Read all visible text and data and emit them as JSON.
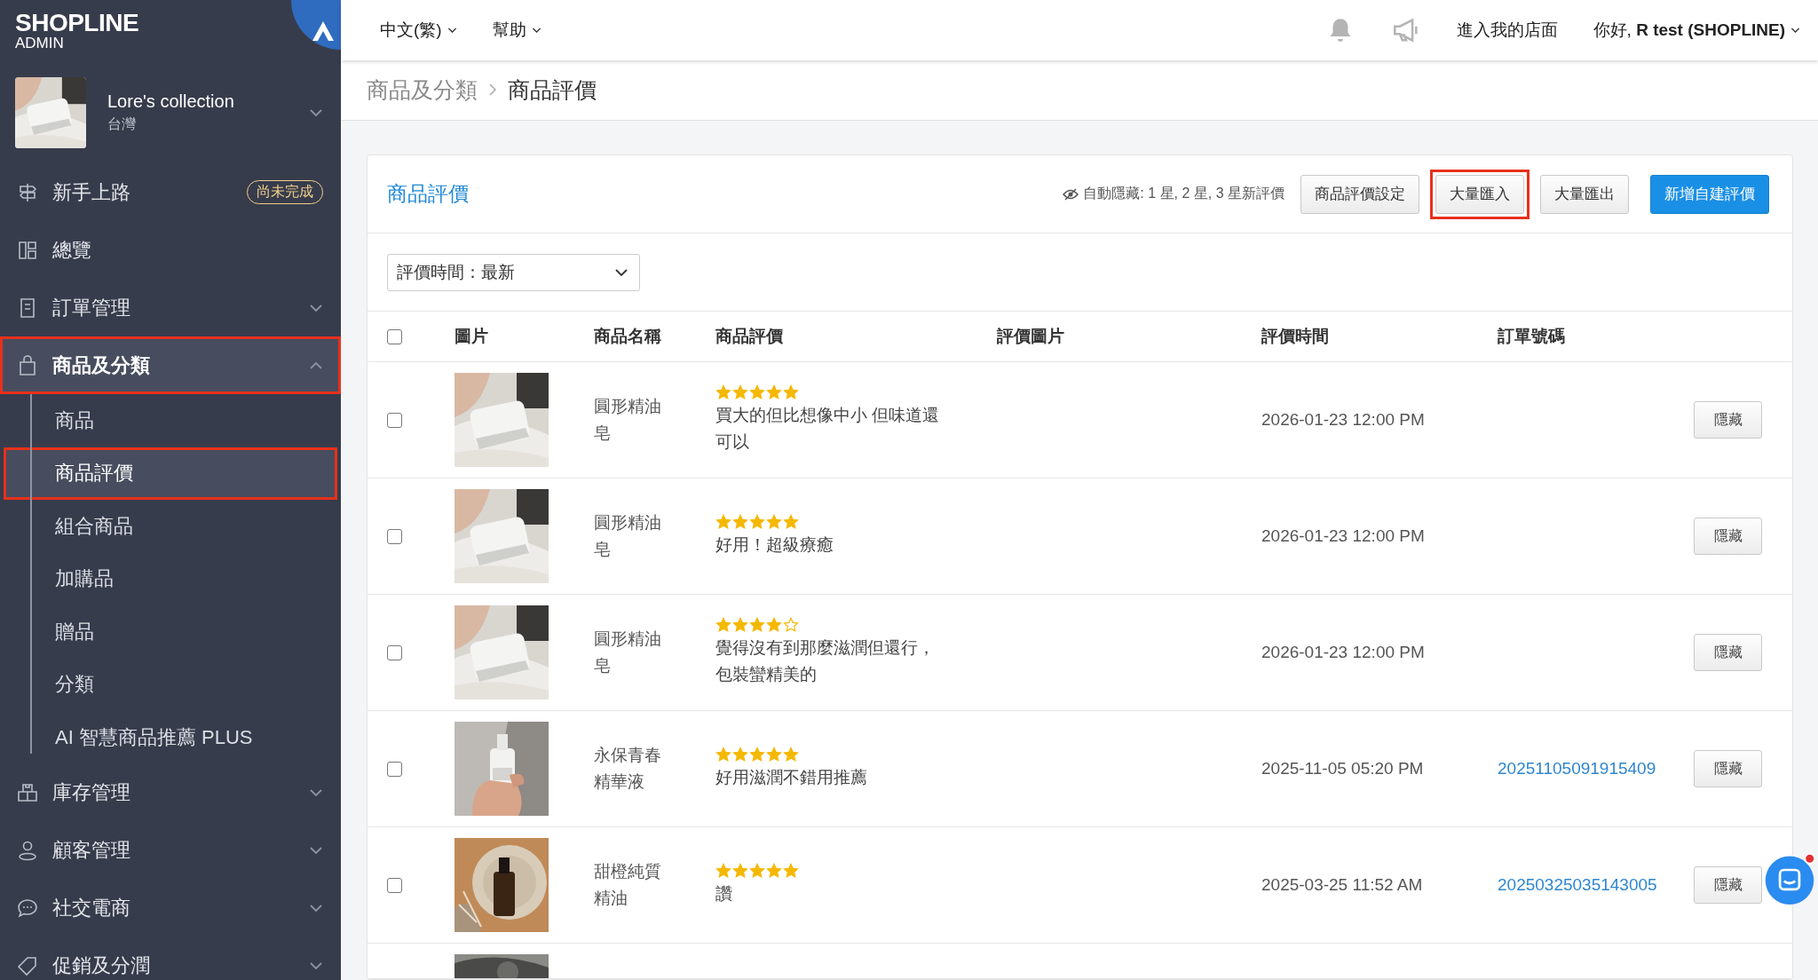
{
  "brand": {
    "name": "SHOPLINE",
    "sub": "ADMIN"
  },
  "store": {
    "name": "Lore's collection",
    "region": "台灣",
    "expanded": false
  },
  "sidebar": {
    "items": [
      {
        "label": "新手上路",
        "badge": "尚未完成",
        "highlighted": false
      },
      {
        "label": "總覽",
        "highlighted": false
      },
      {
        "label": "訂單管理",
        "expanded": false,
        "highlighted": false
      },
      {
        "label": "商品及分類",
        "expanded": true,
        "highlighted": true,
        "children": [
          {
            "label": "商品",
            "selected": false,
            "highlighted": false
          },
          {
            "label": "商品評價",
            "selected": true,
            "highlighted": true
          },
          {
            "label": "組合商品",
            "selected": false,
            "highlighted": false
          },
          {
            "label": "加購品",
            "selected": false,
            "highlighted": false
          },
          {
            "label": "贈品",
            "selected": false,
            "highlighted": false
          },
          {
            "label": "分類",
            "selected": false,
            "highlighted": false
          },
          {
            "label": "AI 智慧商品推薦 PLUS",
            "selected": false,
            "highlighted": false
          }
        ]
      },
      {
        "label": "庫存管理",
        "expanded": false,
        "highlighted": false
      },
      {
        "label": "顧客管理",
        "expanded": false,
        "highlighted": false
      },
      {
        "label": "社交電商",
        "expanded": false,
        "highlighted": false
      },
      {
        "label": "促銷及分潤",
        "expanded": false,
        "highlighted": false
      }
    ]
  },
  "topbar": {
    "menus": [
      "中文(繁)",
      "幫助"
    ],
    "store_link": "進入我的店面",
    "user": "你好, **R test (SHOPLINE)**"
  },
  "breadcrumb": [
    "商品及分類",
    "商品評價"
  ],
  "card": {
    "title": "商品評價",
    "auto_hide": "自動隱藏: 1 星, 2 星, 3 星新評價",
    "buttons": [
      {
        "label": "商品評價設定",
        "kind": "default",
        "highlighted": false
      },
      {
        "label": "大量匯入",
        "kind": "default",
        "highlighted": true
      },
      {
        "label": "大量匯出",
        "kind": "default",
        "highlighted": false
      },
      {
        "label": "新增自建評價",
        "kind": "primary",
        "highlighted": false
      }
    ],
    "filter": {
      "value": "評價時間：最新"
    },
    "select_all_checked": false,
    "columns": [
      "圖片",
      "商品名稱",
      "商品評價",
      "評價圖片",
      "評價時間",
      "訂單號碼"
    ],
    "rows": [
      {
        "checked": false,
        "image": {
          "kind": "picture"
        },
        "product": "圓形精油皂",
        "stars": 5,
        "review": "買大的但比想像中小 但味道還可以",
        "time": "2026-01-23 12:00 PM",
        "action": "隱藏"
      },
      {
        "checked": false,
        "image": {
          "kind": "picture"
        },
        "product": "圓形精油皂",
        "stars": 5,
        "review": "好用！超級療癒",
        "time": "2026-01-23 12:00 PM",
        "action": "隱藏"
      },
      {
        "checked": false,
        "image": {
          "kind": "picture"
        },
        "product": "圓形精油皂",
        "stars": 4,
        "review": "覺得沒有到那麼滋潤但還行，包裝蠻精美的",
        "time": "2026-01-23 12:00 PM",
        "action": "隱藏"
      },
      {
        "checked": false,
        "image": {
          "kind": "picture"
        },
        "product": "永保青春精華液",
        "stars": 5,
        "review": "好用滋潤不錯用推薦",
        "time": "2025-11-05 05:20 PM",
        "order": "20251105091915409",
        "action": "隱藏"
      },
      {
        "checked": false,
        "image": {
          "kind": "picture"
        },
        "product": "甜橙純質精油",
        "stars": 5,
        "review": "讚",
        "time": "2025-03-25 11:52 AM",
        "order": "20250325035143005",
        "action": "隱藏"
      },
      {
        "image": {
          "kind": "picture"
        }
      }
    ]
  }
}
